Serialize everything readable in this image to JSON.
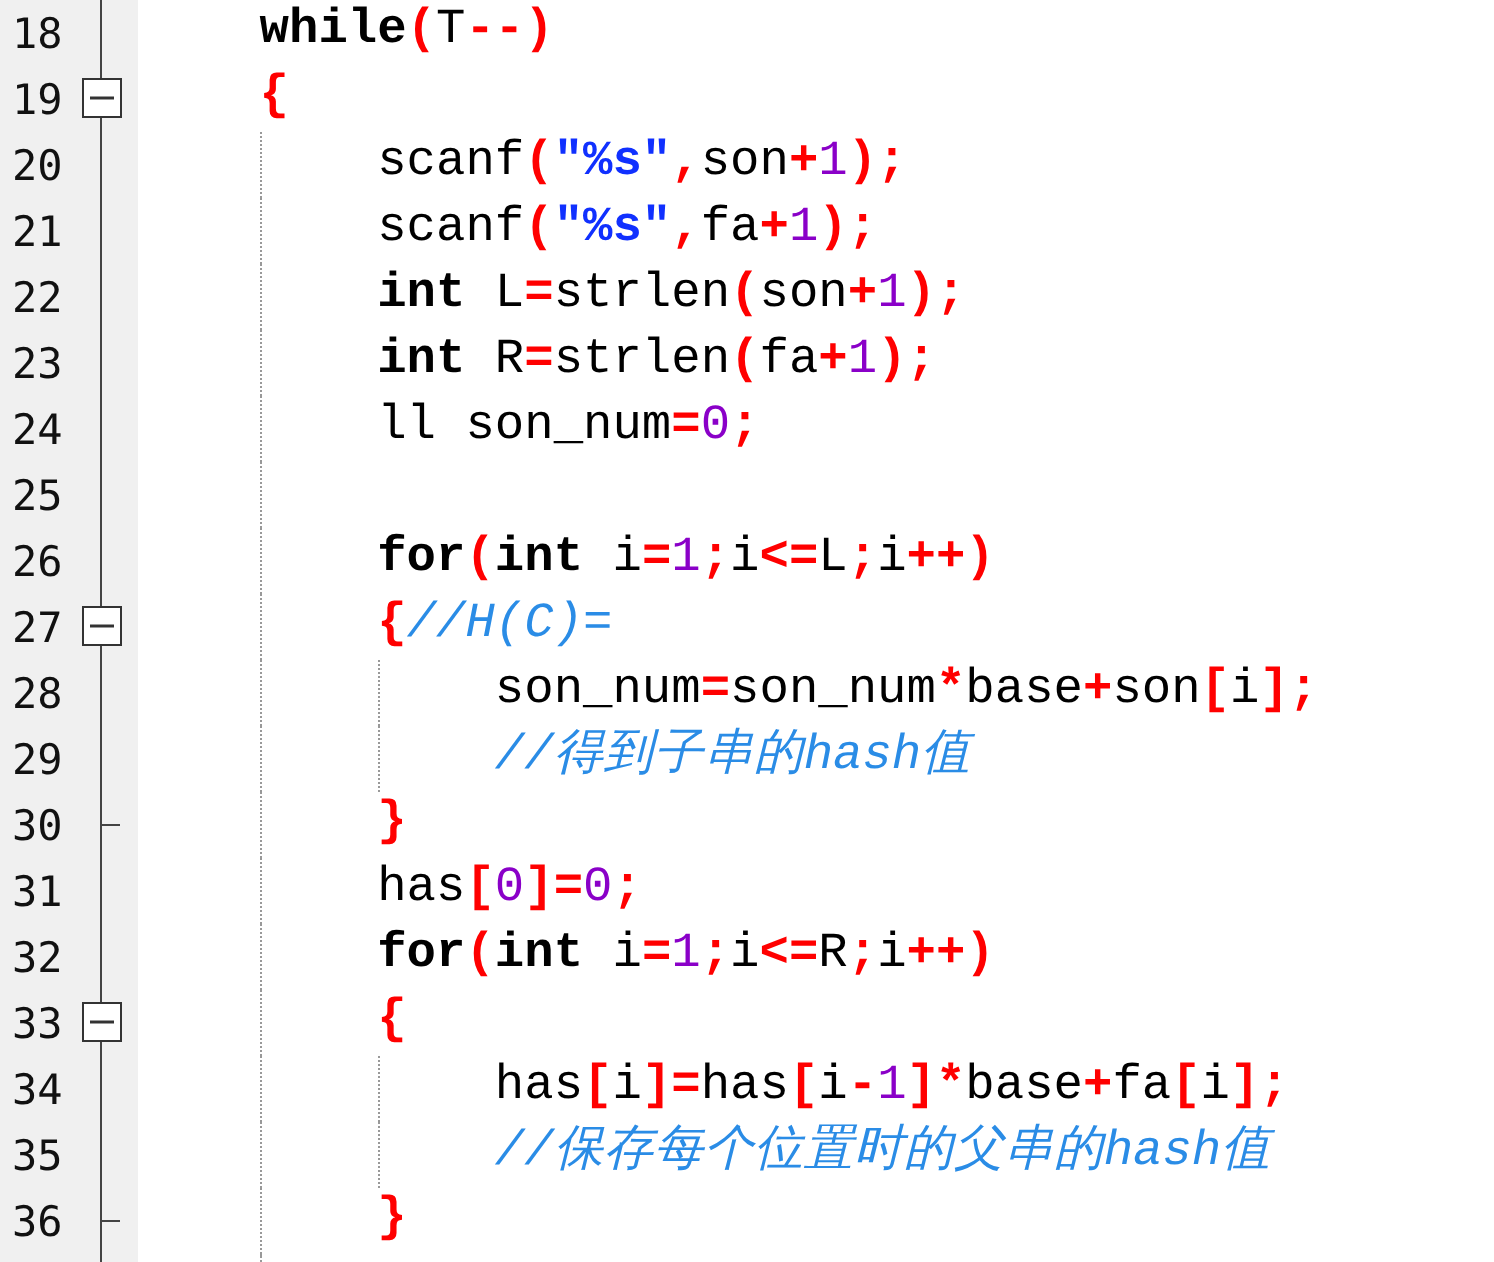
{
  "editor": {
    "lines": [
      {
        "number": "18",
        "fold_start": false,
        "fold_end": false,
        "tokens": [
          {
            "kind": "kw",
            "text": "while"
          },
          {
            "kind": "op",
            "text": "("
          },
          {
            "kind": "id",
            "text": "T"
          },
          {
            "kind": "op",
            "text": "--)"
          }
        ]
      },
      {
        "number": "19",
        "fold_start": true,
        "fold_end": false,
        "tokens": [
          {
            "kind": "op",
            "text": "{"
          }
        ]
      },
      {
        "number": "20",
        "fold_start": false,
        "fold_end": false,
        "tokens": [
          {
            "kind": "id",
            "text": "scanf"
          },
          {
            "kind": "op",
            "text": "("
          },
          {
            "kind": "str",
            "text": "\"%s\""
          },
          {
            "kind": "op",
            "text": ","
          },
          {
            "kind": "id",
            "text": "son"
          },
          {
            "kind": "op",
            "text": "+"
          },
          {
            "kind": "num",
            "text": "1"
          },
          {
            "kind": "op",
            "text": ");"
          }
        ]
      },
      {
        "number": "21",
        "fold_start": false,
        "fold_end": false,
        "tokens": [
          {
            "kind": "id",
            "text": "scanf"
          },
          {
            "kind": "op",
            "text": "("
          },
          {
            "kind": "str",
            "text": "\"%s\""
          },
          {
            "kind": "op",
            "text": ","
          },
          {
            "kind": "id",
            "text": "fa"
          },
          {
            "kind": "op",
            "text": "+"
          },
          {
            "kind": "num",
            "text": "1"
          },
          {
            "kind": "op",
            "text": ");"
          }
        ]
      },
      {
        "number": "22",
        "fold_start": false,
        "fold_end": false,
        "tokens": [
          {
            "kind": "kw",
            "text": "int"
          },
          {
            "kind": "id",
            "text": " L"
          },
          {
            "kind": "op",
            "text": "="
          },
          {
            "kind": "id",
            "text": "strlen"
          },
          {
            "kind": "op",
            "text": "("
          },
          {
            "kind": "id",
            "text": "son"
          },
          {
            "kind": "op",
            "text": "+"
          },
          {
            "kind": "num",
            "text": "1"
          },
          {
            "kind": "op",
            "text": ");"
          }
        ]
      },
      {
        "number": "23",
        "fold_start": false,
        "fold_end": false,
        "tokens": [
          {
            "kind": "kw",
            "text": "int"
          },
          {
            "kind": "id",
            "text": " R"
          },
          {
            "kind": "op",
            "text": "="
          },
          {
            "kind": "id",
            "text": "strlen"
          },
          {
            "kind": "op",
            "text": "("
          },
          {
            "kind": "id",
            "text": "fa"
          },
          {
            "kind": "op",
            "text": "+"
          },
          {
            "kind": "num",
            "text": "1"
          },
          {
            "kind": "op",
            "text": ");"
          }
        ]
      },
      {
        "number": "24",
        "fold_start": false,
        "fold_end": false,
        "tokens": [
          {
            "kind": "id",
            "text": "ll son_num"
          },
          {
            "kind": "op",
            "text": "="
          },
          {
            "kind": "num",
            "text": "0"
          },
          {
            "kind": "op",
            "text": ";"
          }
        ]
      },
      {
        "number": "25",
        "fold_start": false,
        "fold_end": false
      },
      {
        "number": "26",
        "fold_start": false,
        "fold_end": false,
        "tokens": [
          {
            "kind": "kw",
            "text": "for"
          },
          {
            "kind": "op",
            "text": "("
          },
          {
            "kind": "kw",
            "text": "int"
          },
          {
            "kind": "id",
            "text": " i"
          },
          {
            "kind": "op",
            "text": "="
          },
          {
            "kind": "num",
            "text": "1"
          },
          {
            "kind": "op",
            "text": ";"
          },
          {
            "kind": "id",
            "text": "i"
          },
          {
            "kind": "op",
            "text": "<="
          },
          {
            "kind": "id",
            "text": "L"
          },
          {
            "kind": "op",
            "text": ";"
          },
          {
            "kind": "id",
            "text": "i"
          },
          {
            "kind": "op",
            "text": "++)"
          }
        ]
      },
      {
        "number": "27",
        "fold_start": true,
        "fold_end": false,
        "tokens": [
          {
            "kind": "op",
            "text": "{"
          },
          {
            "kind": "cm",
            "text": "//H(C)="
          }
        ]
      },
      {
        "number": "28",
        "fold_start": false,
        "fold_end": false,
        "tokens": [
          {
            "kind": "id",
            "text": "son_num"
          },
          {
            "kind": "op",
            "text": "="
          },
          {
            "kind": "id",
            "text": "son_num"
          },
          {
            "kind": "op",
            "text": "*"
          },
          {
            "kind": "id",
            "text": "base"
          },
          {
            "kind": "op",
            "text": "+"
          },
          {
            "kind": "id",
            "text": "son"
          },
          {
            "kind": "op",
            "text": "["
          },
          {
            "kind": "id",
            "text": "i"
          },
          {
            "kind": "op",
            "text": "];"
          }
        ]
      },
      {
        "number": "29",
        "fold_start": false,
        "fold_end": false,
        "tokens": [
          {
            "kind": "cm",
            "text": "//得到子串的hash值"
          }
        ]
      },
      {
        "number": "30",
        "fold_start": false,
        "fold_end": true,
        "tokens": [
          {
            "kind": "op",
            "text": "}"
          }
        ]
      },
      {
        "number": "31",
        "fold_start": false,
        "fold_end": false,
        "tokens": [
          {
            "kind": "id",
            "text": "has"
          },
          {
            "kind": "op",
            "text": "["
          },
          {
            "kind": "num",
            "text": "0"
          },
          {
            "kind": "op",
            "text": "]="
          },
          {
            "kind": "num",
            "text": "0"
          },
          {
            "kind": "op",
            "text": ";"
          }
        ]
      },
      {
        "number": "32",
        "fold_start": false,
        "fold_end": false,
        "tokens": [
          {
            "kind": "kw",
            "text": "for"
          },
          {
            "kind": "op",
            "text": "("
          },
          {
            "kind": "kw",
            "text": "int"
          },
          {
            "kind": "id",
            "text": " i"
          },
          {
            "kind": "op",
            "text": "="
          },
          {
            "kind": "num",
            "text": "1"
          },
          {
            "kind": "op",
            "text": ";"
          },
          {
            "kind": "id",
            "text": "i"
          },
          {
            "kind": "op",
            "text": "<="
          },
          {
            "kind": "id",
            "text": "R"
          },
          {
            "kind": "op",
            "text": ";"
          },
          {
            "kind": "id",
            "text": "i"
          },
          {
            "kind": "op",
            "text": "++)"
          }
        ]
      },
      {
        "number": "33",
        "fold_start": true,
        "fold_end": false,
        "tokens": [
          {
            "kind": "op",
            "text": "{"
          }
        ]
      },
      {
        "number": "34",
        "fold_start": false,
        "fold_end": false,
        "tokens": [
          {
            "kind": "id",
            "text": "has"
          },
          {
            "kind": "op",
            "text": "["
          },
          {
            "kind": "id",
            "text": "i"
          },
          {
            "kind": "op",
            "text": "]="
          },
          {
            "kind": "id",
            "text": "has"
          },
          {
            "kind": "op",
            "text": "["
          },
          {
            "kind": "id",
            "text": "i"
          },
          {
            "kind": "op",
            "text": "-"
          },
          {
            "kind": "num",
            "text": "1"
          },
          {
            "kind": "op",
            "text": "]*"
          },
          {
            "kind": "id",
            "text": "base"
          },
          {
            "kind": "op",
            "text": "+"
          },
          {
            "kind": "id",
            "text": "fa"
          },
          {
            "kind": "op",
            "text": "["
          },
          {
            "kind": "id",
            "text": "i"
          },
          {
            "kind": "op",
            "text": "];"
          }
        ]
      },
      {
        "number": "35",
        "fold_start": false,
        "fold_end": false,
        "tokens": [
          {
            "kind": "cm",
            "text": "//保存每个位置时的父串的hash值"
          }
        ]
      },
      {
        "number": "36",
        "fold_start": false,
        "fold_end": true,
        "tokens": [
          {
            "kind": "op",
            "text": "}"
          }
        ]
      }
    ]
  }
}
